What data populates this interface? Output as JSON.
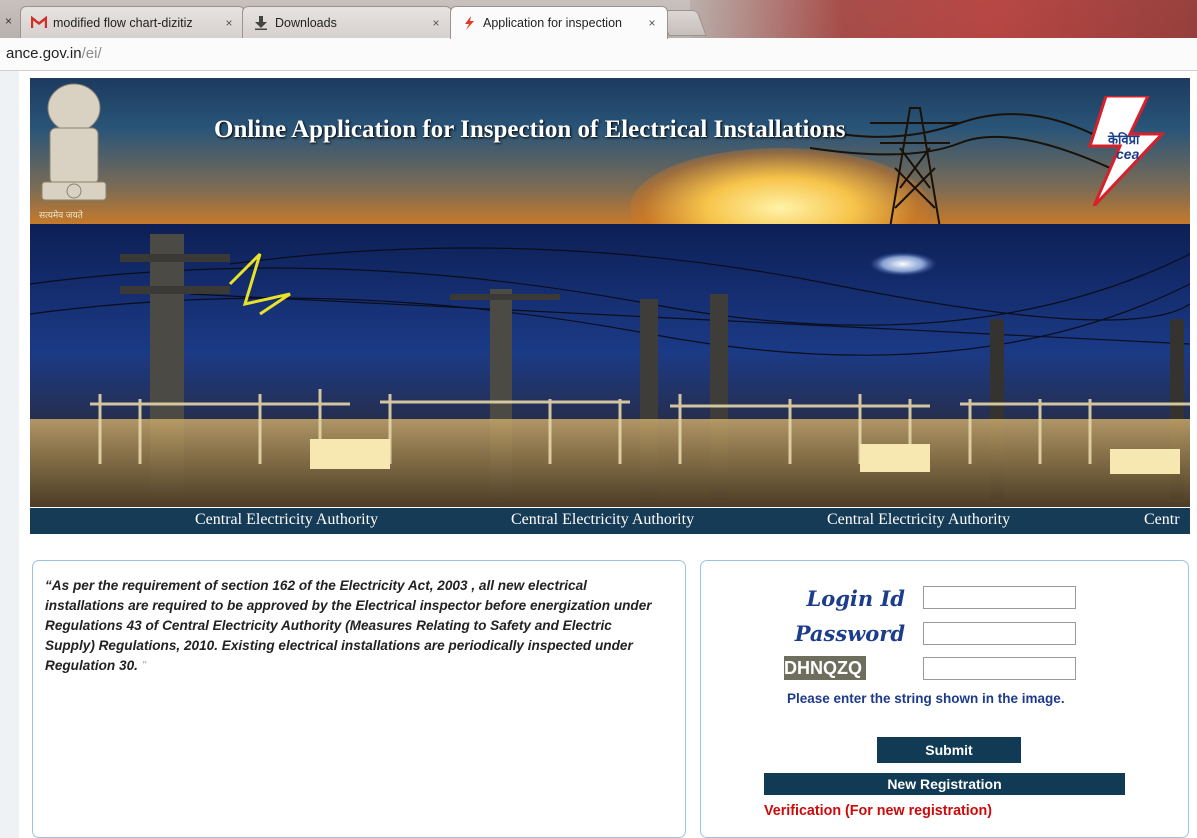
{
  "browser": {
    "tabs": [
      {
        "label": "modified flow chart-dizitiz",
        "icon": "gmail-icon"
      },
      {
        "label": "Downloads",
        "icon": "download-icon"
      },
      {
        "label": "Application for inspection",
        "icon": "cea-favicon-icon"
      }
    ],
    "tab_close_glyph": "×",
    "url_host": "ance.gov.in",
    "url_path": "/ei/"
  },
  "header": {
    "title": "Online Application for Inspection of Electrical Installations",
    "emblem_motto": "सत्यमेव जयते",
    "logo_hindi": "केविप्रा",
    "logo_english": "cea"
  },
  "marquee": {
    "items": [
      "Central Electricity Authority",
      "Central Electricity Authority",
      "Central Electricity Authority",
      "Centr"
    ]
  },
  "info": {
    "text": "“As per the requirement of section 162 of the Electricity Act, 2003 , all new electrical installations are required to be approved by the Electrical inspector before energization under Regulations 43 of Central Electricity Authority (Measures Relating to Safety and Electric Supply) Regulations, 2010. Existing electrical installations are periodically inspected under Regulation 30.",
    "closing_mark": "\""
  },
  "login": {
    "login_id_label": "Login Id",
    "login_id_value": "",
    "password_label": "Password",
    "password_value": "",
    "captcha_text": "DHNQZQ",
    "captcha_value": "",
    "captcha_hint": "Please enter the string shown in the image.",
    "submit_label": "Submit",
    "new_registration_label": "New Registration",
    "verification_link": "Verification (For new registration)"
  },
  "colors": {
    "nav_dark": "#113a55",
    "label_blue": "#1c3c8c",
    "link_red": "#cc0a0a",
    "panel_border": "#9ec3e2"
  }
}
